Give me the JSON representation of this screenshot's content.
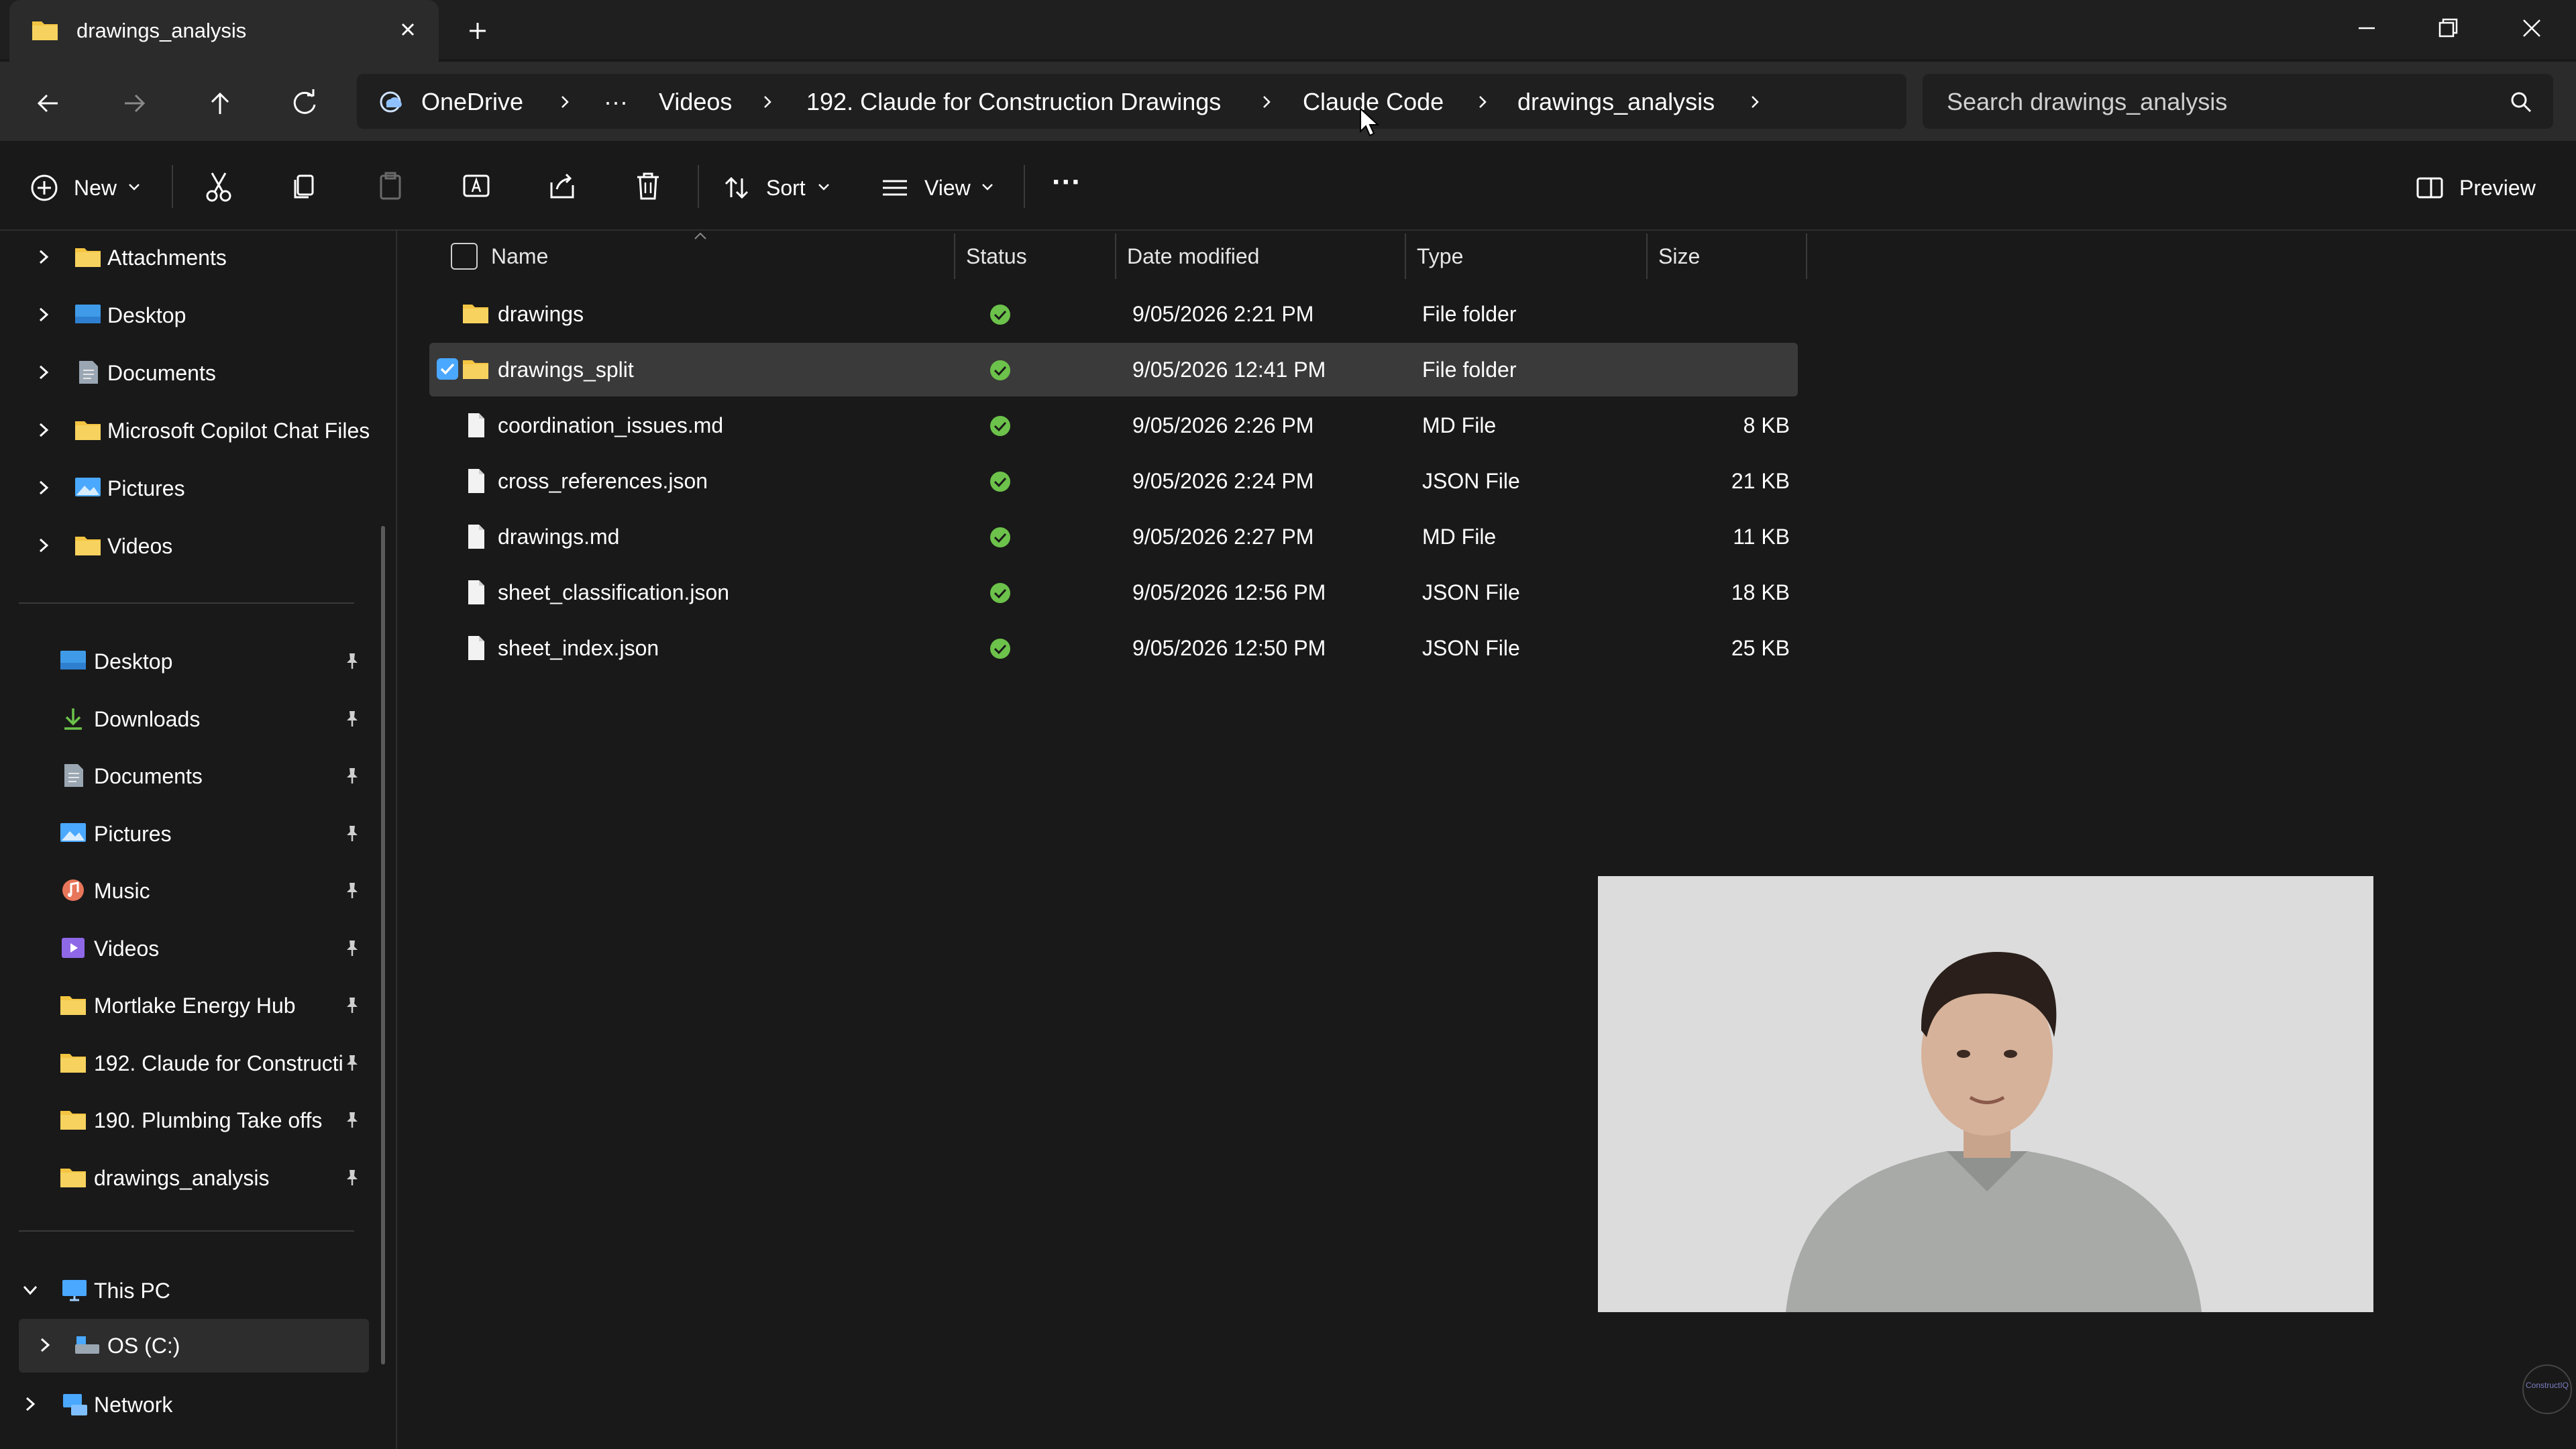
{
  "window": {
    "tab_title": "drawings_analysis",
    "close_tab_icon": "close-icon",
    "new_tab_icon": "plus-icon"
  },
  "address": {
    "crumbs": [
      "OneDrive",
      "···",
      "Videos",
      "192. Claude for Construction Drawings",
      "Claude Code",
      "drawings_analysis"
    ],
    "search_placeholder": "Search drawings_analysis"
  },
  "toolbar": {
    "new_label": "New",
    "sort_label": "Sort",
    "view_label": "View",
    "more_label": "···",
    "preview_label": "Preview"
  },
  "sidebar": {
    "tree": [
      {
        "label": "Attachments",
        "icon": "folder-icon"
      },
      {
        "label": "Desktop",
        "icon": "desktop-icon"
      },
      {
        "label": "Documents",
        "icon": "document-icon"
      },
      {
        "label": "Microsoft Copilot Chat Files",
        "icon": "folder-icon"
      },
      {
        "label": "Pictures",
        "icon": "pictures-icon"
      },
      {
        "label": "Videos",
        "icon": "folder-icon"
      }
    ],
    "quick": [
      {
        "label": "Desktop",
        "icon": "desktop-icon"
      },
      {
        "label": "Downloads",
        "icon": "download-icon"
      },
      {
        "label": "Documents",
        "icon": "document-icon"
      },
      {
        "label": "Pictures",
        "icon": "pictures-icon"
      },
      {
        "label": "Music",
        "icon": "music-icon"
      },
      {
        "label": "Videos",
        "icon": "videos-icon"
      },
      {
        "label": "Mortlake Energy Hub",
        "icon": "folder-icon"
      },
      {
        "label": "192. Claude for Constructi",
        "icon": "folder-icon"
      },
      {
        "label": "190. Plumbing Take offs",
        "icon": "folder-icon"
      },
      {
        "label": "drawings_analysis",
        "icon": "folder-icon"
      }
    ],
    "this_pc": "This PC",
    "os_drive": "OS (C:)",
    "network": "Network"
  },
  "files": {
    "columns": {
      "name": "Name",
      "status": "Status",
      "date": "Date modified",
      "type": "Type",
      "size": "Size"
    },
    "rows": [
      {
        "name": "drawings",
        "date": "9/05/2026 2:21 PM",
        "type": "File folder",
        "size": "",
        "kind": "folder",
        "selected": false
      },
      {
        "name": "drawings_split",
        "date": "9/05/2026 12:41 PM",
        "type": "File folder",
        "size": "",
        "kind": "folder",
        "selected": true
      },
      {
        "name": "coordination_issues.md",
        "date": "9/05/2026 2:26 PM",
        "type": "MD File",
        "size": "8 KB",
        "kind": "file",
        "selected": false
      },
      {
        "name": "cross_references.json",
        "date": "9/05/2026 2:24 PM",
        "type": "JSON File",
        "size": "21 KB",
        "kind": "file",
        "selected": false
      },
      {
        "name": "drawings.md",
        "date": "9/05/2026 2:27 PM",
        "type": "MD File",
        "size": "11 KB",
        "kind": "file",
        "selected": false
      },
      {
        "name": "sheet_classification.json",
        "date": "9/05/2026 12:56 PM",
        "type": "JSON File",
        "size": "18 KB",
        "kind": "file",
        "selected": false
      },
      {
        "name": "sheet_index.json",
        "date": "9/05/2026 12:50 PM",
        "type": "JSON File",
        "size": "25 KB",
        "kind": "file",
        "selected": false
      }
    ]
  },
  "colors": {
    "folder": "#f4c542",
    "status_synced": "#6cc24a",
    "accent": "#4aa8ff",
    "selection": "#3a3a3a"
  },
  "watermark_text": "ConstructIQ"
}
